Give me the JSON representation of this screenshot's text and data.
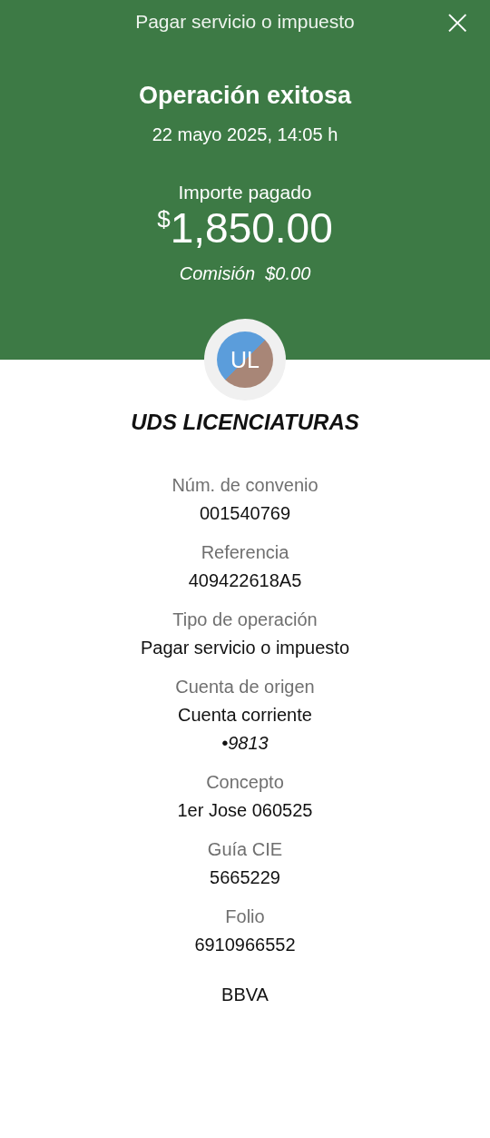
{
  "header": {
    "title": "Pagar servicio o impuesto",
    "close": "×"
  },
  "status": {
    "heading": "Operación exitosa",
    "date": "22 mayo 2025, 14:05 h",
    "amount_label": "Importe pagado",
    "currency": "$",
    "amount": "1,850.00",
    "commission": "Comisión  $0.00"
  },
  "payee": {
    "initials": "UL",
    "name": "UDS LICENCIATURAS"
  },
  "details": [
    {
      "label": "Núm. de convenio",
      "value": "001540769"
    },
    {
      "label": "Referencia",
      "value": "409422618A5"
    },
    {
      "label": "Tipo de operación",
      "value": "Pagar servicio o impuesto"
    },
    {
      "label": "Cuenta de origen",
      "value": "Cuenta corriente",
      "note": "•9813"
    },
    {
      "label": "Concepto",
      "value": "1er Jose 060525"
    },
    {
      "label": "Guía CIE",
      "value": "5665229"
    },
    {
      "label": "Folio",
      "value": "6910966552"
    }
  ],
  "footer": "BBVA"
}
